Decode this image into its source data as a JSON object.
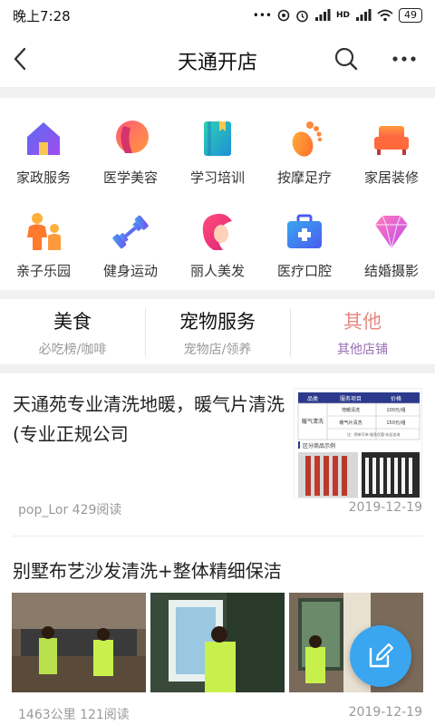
{
  "status": {
    "time": "晚上7:28",
    "network": "HD",
    "battery": "49"
  },
  "header": {
    "title": "天通开店"
  },
  "services": [
    {
      "label": "家政服务",
      "icon": "house-icon"
    },
    {
      "label": "医学美容",
      "icon": "face-profile-icon"
    },
    {
      "label": "学习培训",
      "icon": "book-icon"
    },
    {
      "label": "按摩足疗",
      "icon": "foot-icon"
    },
    {
      "label": "家居装修",
      "icon": "sofa-icon"
    },
    {
      "label": "亲子乐园",
      "icon": "parent-child-icon"
    },
    {
      "label": "健身运动",
      "icon": "dumbbell-icon"
    },
    {
      "label": "丽人美发",
      "icon": "hair-icon"
    },
    {
      "label": "医疗口腔",
      "icon": "medical-kit-icon"
    },
    {
      "label": "结婚摄影",
      "icon": "diamond-icon"
    }
  ],
  "categories": [
    {
      "title": "美食",
      "subtitle": "必吃榜/咖啡"
    },
    {
      "title": "宠物服务",
      "subtitle": "宠物店/领养"
    },
    {
      "title": "其他",
      "subtitle": "其他店铺"
    }
  ],
  "articles": [
    {
      "title": "天通苑专业清洗地暖，暖气片清洗(专业正规公司",
      "author_reads": "pop_Lor 429阅读",
      "date": "2019-12-19",
      "thumb": {
        "headers": [
          "品类",
          "服务项目",
          "价格"
        ],
        "row_label": "暖气清洗",
        "items": [
          {
            "name": "地暖清洗",
            "price": "100元/组"
          },
          {
            "name": "暖气片清洗",
            "price": "150元/组"
          }
        ],
        "note": "注：预单可单·服多优惠·欢迎咨询",
        "caption": "区分商品示例"
      }
    },
    {
      "title": "别墅布艺沙发清洗+整体精细保洁",
      "author_reads": "1463公里 121阅读",
      "date": "2019-12-19"
    }
  ],
  "colors": {
    "accent_pink": "#e88a82",
    "accent_purple": "#9a6fb8",
    "fab": "#3aa6f0"
  }
}
